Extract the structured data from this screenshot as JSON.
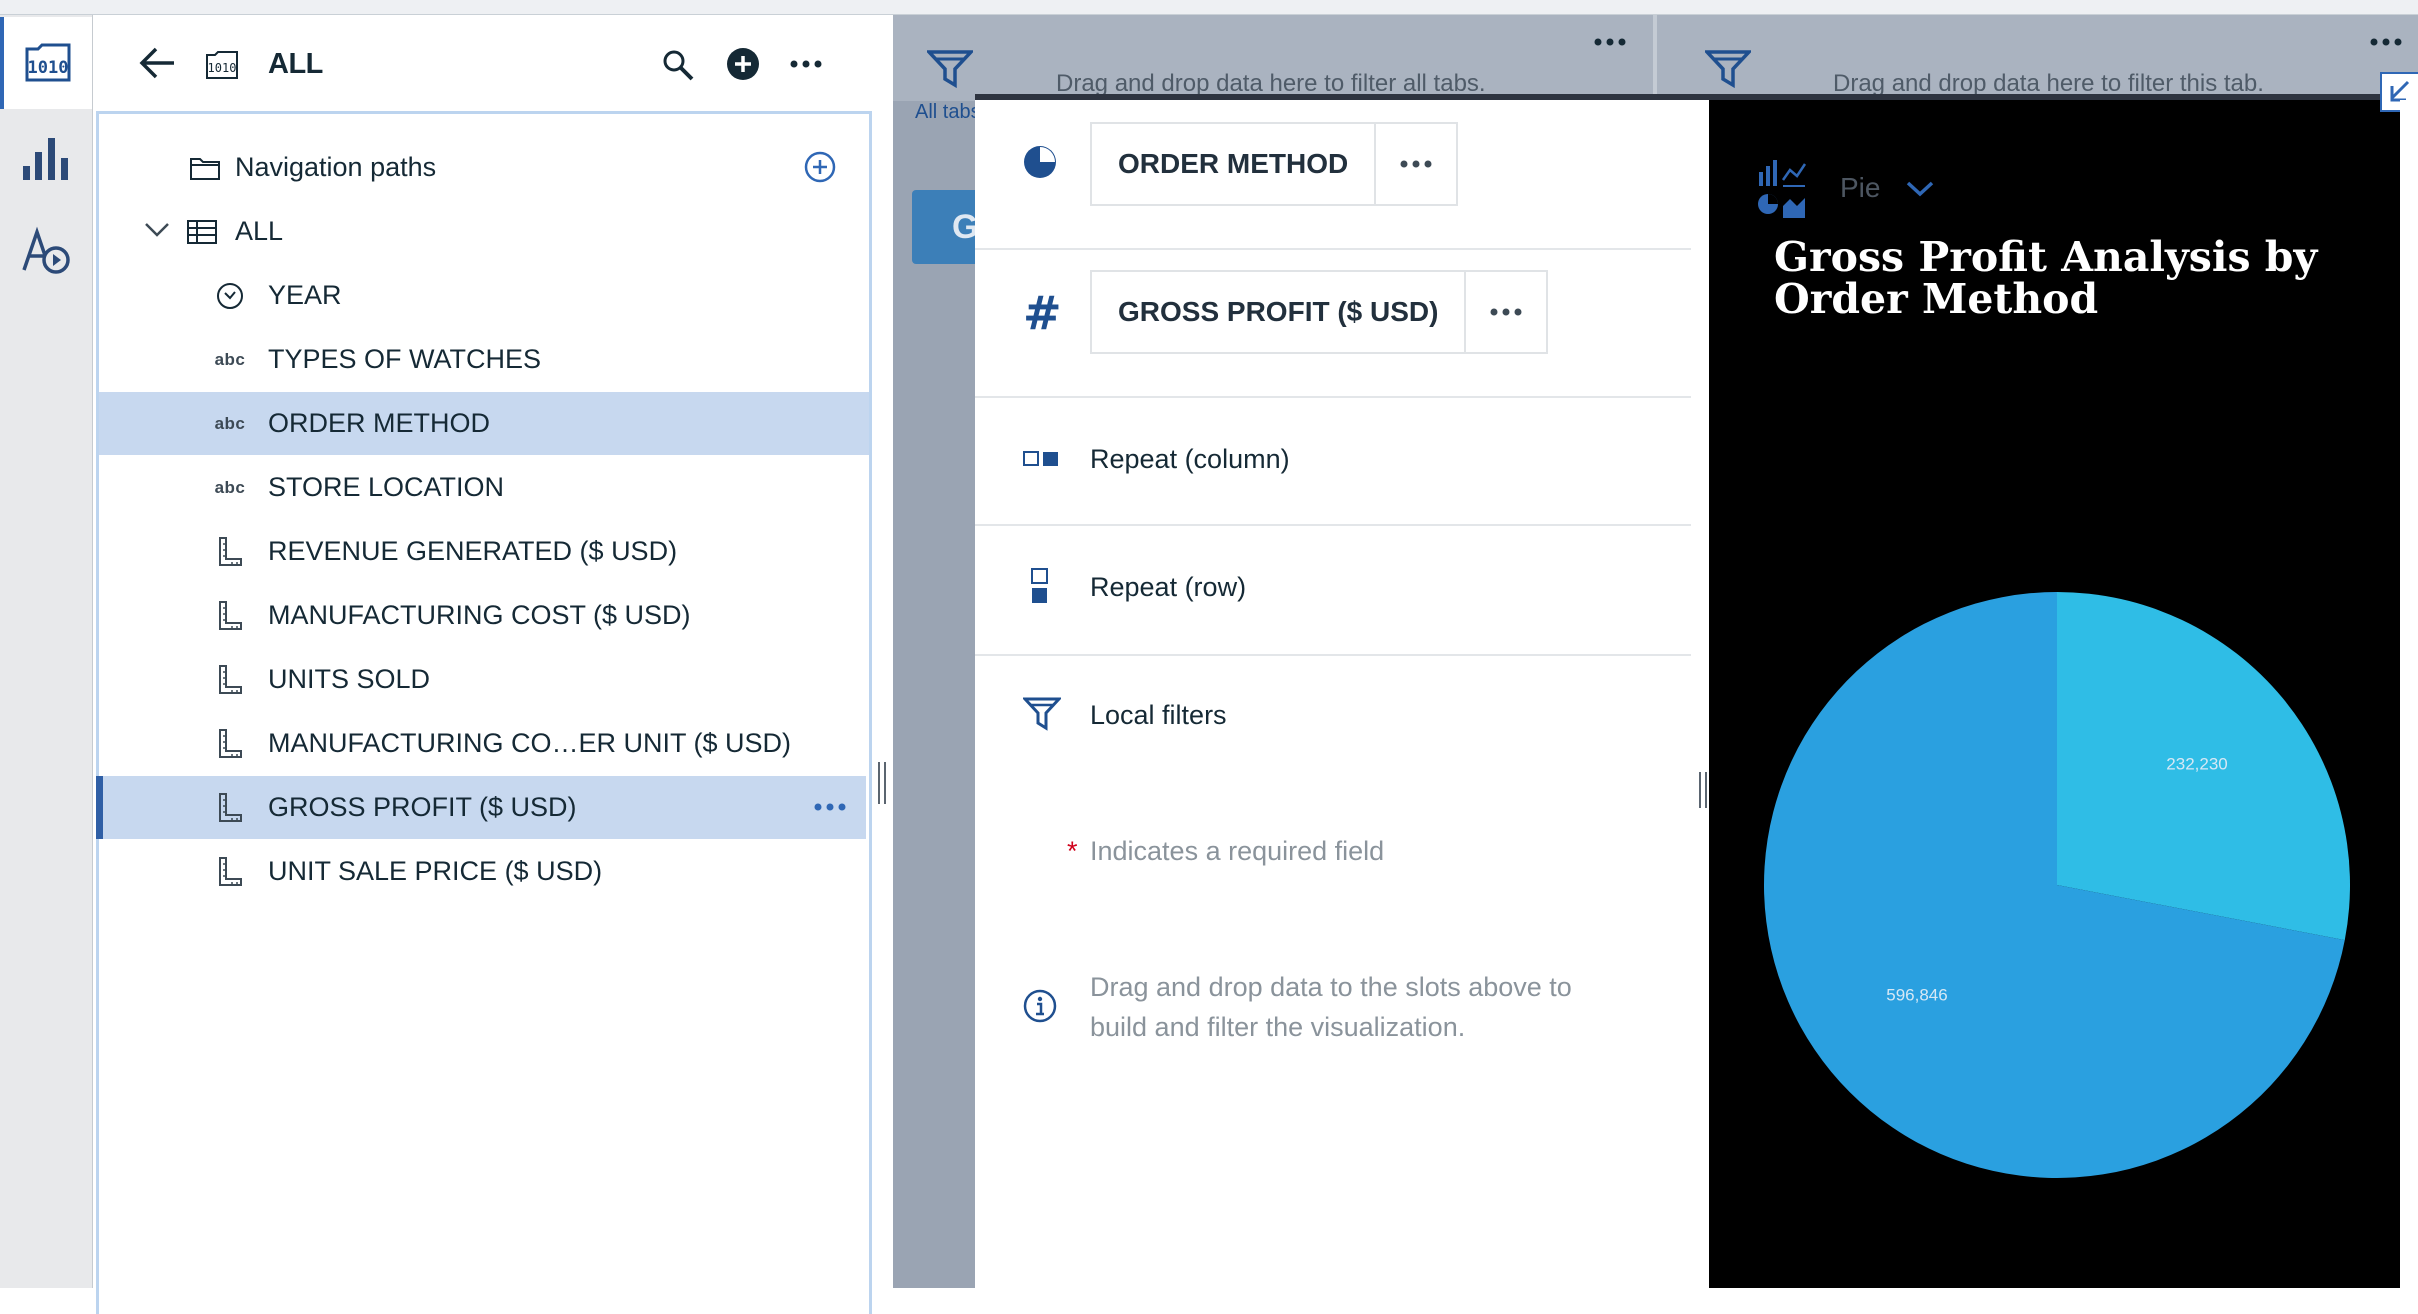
{
  "dataPanel": {
    "title": "ALL",
    "tree": [
      {
        "label": "Navigation paths",
        "icon": "folder-icon",
        "indent": 0
      },
      {
        "label": "ALL",
        "icon": "table-icon",
        "indent": 0
      },
      {
        "label": "YEAR",
        "icon": "clock-icon"
      },
      {
        "label": "TYPES OF WATCHES",
        "icon": "abc"
      },
      {
        "label": "ORDER METHOD",
        "icon": "abc"
      },
      {
        "label": "STORE LOCATION",
        "icon": "abc"
      },
      {
        "label": "REVENUE GENERATED ($ USD)",
        "icon": "ruler-icon"
      },
      {
        "label": "MANUFACTURING COST ($ USD)",
        "icon": "ruler-icon"
      },
      {
        "label": "UNITS SOLD",
        "icon": "ruler-icon"
      },
      {
        "label": "MANUFACTURING CO…ER UNIT ($ USD)",
        "icon": "ruler-icon"
      },
      {
        "label": "GROSS PROFIT ($ USD)",
        "icon": "ruler-icon"
      },
      {
        "label": "UNIT SALE PRICE ($ USD)",
        "icon": "ruler-icon"
      }
    ],
    "abc_text": "abc"
  },
  "dashboard": {
    "filter_all_msg": "Drag and drop data here to filter all tabs.",
    "filter_tab_msg": "Drag and drop data here to filter this tab.",
    "all_tabs_label": "All tabs",
    "tab_button_text": "G"
  },
  "config": {
    "slot_order_method": "ORDER METHOD",
    "slot_gross_profit": "GROSS PROFIT ($ USD)",
    "repeat_column": "Repeat (column)",
    "repeat_row": "Repeat (row)",
    "local_filters": "Local filters",
    "required_star": "*",
    "required_text": "Indicates a required field",
    "info_text_1": "Drag and drop data to the slots above to",
    "info_text_2": "build and filter the visualization.",
    "hash_symbol": "#"
  },
  "chart": {
    "viz_type": "Pie",
    "title_line1": "Gross Profit Analysis by",
    "title_line2": "Order Method",
    "colors": [
      "#2aa0e0",
      "#2fbde6"
    ]
  },
  "chart_data": {
    "type": "pie",
    "title": "Gross Profit Analysis by Order Method",
    "values": [
      596846,
      232230
    ],
    "value_labels": [
      "596,846",
      "232,230"
    ]
  }
}
